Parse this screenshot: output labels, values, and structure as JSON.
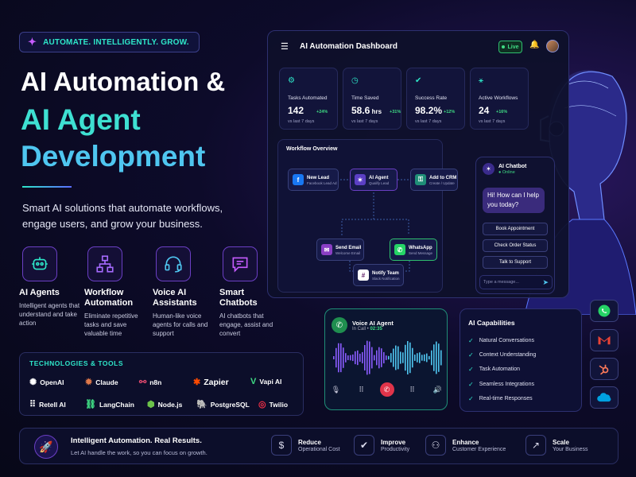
{
  "hero": {
    "tagline": "AUTOMATE. INTELLIGENTLY. GROW.",
    "title_line1": "AI Automation &",
    "title_line2": "AI Agent",
    "title_line3": "Development",
    "subtitle": "Smart AI solutions that automate workflows, engage users, and grow your business."
  },
  "features": [
    {
      "title_l1": "AI Agents",
      "title_l2": "",
      "desc": "Intelligent agents that understand and take action",
      "icon": "robot-icon"
    },
    {
      "title_l1": "Workflow",
      "title_l2": "Automation",
      "desc": "Eliminate repetitive tasks and save valuable time",
      "icon": "workflow-icon"
    },
    {
      "title_l1": "Voice AI",
      "title_l2": "Assistants",
      "desc": "Human-like voice agents for calls and support",
      "icon": "headset-icon"
    },
    {
      "title_l1": "Smart",
      "title_l2": "Chatbots",
      "desc": "AI chatbots that engage, assist and convert",
      "icon": "chat-icon"
    }
  ],
  "tech": {
    "heading": "TECHNOLOGIES & TOOLS",
    "tools": [
      "OpenAI",
      "Claude",
      "n8n",
      "Zapier",
      "Vapi AI",
      "Retell AI",
      "LangChain",
      "Node.js",
      "PostgreSQL",
      "Twilio"
    ]
  },
  "dashboard": {
    "title": "AI Automation Dashboard",
    "live": "Live",
    "stats": [
      {
        "label": "Tasks Automated",
        "value": "142",
        "unit": "",
        "delta": "+24%",
        "compare": "vs last 7 days"
      },
      {
        "label": "Time Saved",
        "value": "58.6",
        "unit": " hrs",
        "delta": "+31%",
        "compare": "vs last 7 days"
      },
      {
        "label": "Success Rate",
        "value": "98.2%",
        "unit": "",
        "delta": "+12%",
        "compare": "vs last 7 days"
      },
      {
        "label": "Active Workflows",
        "value": "24",
        "unit": "",
        "delta": "+16%",
        "compare": "vs last 7 days"
      }
    ],
    "workflow": {
      "title": "Workflow Overview",
      "nodes": [
        {
          "title": "New Lead",
          "sub": "Facebook Lead Ad"
        },
        {
          "title": "AI Agent",
          "sub": "Qualify Lead"
        },
        {
          "title": "Add to CRM",
          "sub": "Create / Update"
        },
        {
          "title": "Send Email",
          "sub": "Welcome Email"
        },
        {
          "title": "WhatsApp",
          "sub": "Send Message"
        },
        {
          "title": "Notify Team",
          "sub": "Slack Notification"
        }
      ]
    }
  },
  "chatbot": {
    "name": "AI Chatbot",
    "status": "Online",
    "greeting": "Hi! How can I help you today?",
    "options": [
      "Book Appointment",
      "Check Order Status",
      "Talk to Support"
    ],
    "input_placeholder": "Type a message..."
  },
  "voice": {
    "title": "Voice AI Agent",
    "status": "In Call",
    "timer": "02:35"
  },
  "capabilities": {
    "title": "AI Capabilities",
    "items": [
      "Natural Conversations",
      "Context Understanding",
      "Task Automation",
      "Seamless Integrations",
      "Real-time Responses"
    ]
  },
  "apps": [
    "whatsapp-icon",
    "gmail-icon",
    "hubspot-icon",
    "salesforce-icon"
  ],
  "footer": {
    "title": "Intelligent Automation. Real Results.",
    "subtitle": "Let AI handle the work, so you can focus on growth.",
    "benefits": [
      {
        "label": "Reduce",
        "desc": "Operational Cost"
      },
      {
        "label": "Improve",
        "desc": "Productivity"
      },
      {
        "label": "Enhance",
        "desc": "Customer Experience"
      },
      {
        "label": "Scale",
        "desc": "Your Business"
      }
    ]
  },
  "colors": {
    "accent_teal": "#2ee6c9",
    "accent_blue": "#4fc6f0",
    "accent_purple": "#6b3fc4",
    "live_green": "#3fdc84"
  }
}
